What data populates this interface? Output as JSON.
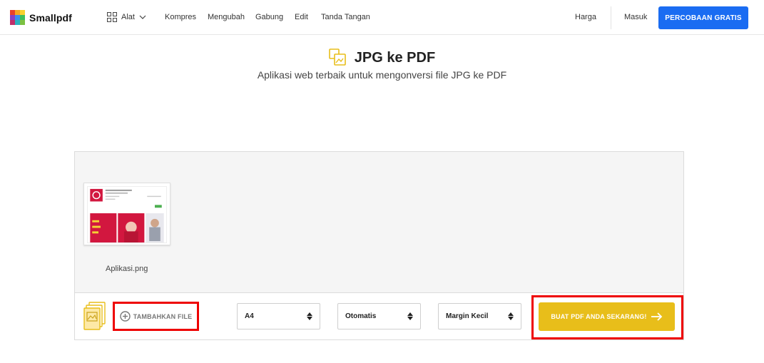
{
  "header": {
    "brand": "Smallpdf",
    "tools_label": "Alat",
    "nav": [
      "Kompres",
      "Mengubah",
      "Gabung",
      "Edit",
      "Tanda Tangan"
    ],
    "pricing": "Harga",
    "login": "Masuk",
    "trial_button": "PERCOBAAN GRATIS"
  },
  "page": {
    "title": "JPG ke PDF",
    "subtitle": "Aplikasi web terbaik untuk mengonversi file JPG ke PDF"
  },
  "workspace": {
    "file_name": "Aplikasi.png",
    "add_file_label": "TAMBAHKAN FILE",
    "page_size": "A4",
    "orientation": "Otomatis",
    "margin": "Margin Kecil",
    "create_button": "BUAT PDF ANDA SEKARANG!"
  },
  "colors": {
    "primary_blue": "#1a6cf2",
    "accent_yellow": "#e8be1a",
    "annotation_red": "#e00000"
  },
  "icons": [
    "grid-icon",
    "chevron-down-icon",
    "jpg-file-icon",
    "plus-circle-icon",
    "sort-arrows-icon",
    "arrow-right-icon",
    "red-down-arrow-icon"
  ]
}
